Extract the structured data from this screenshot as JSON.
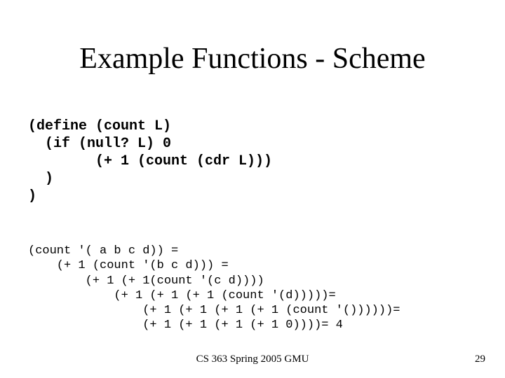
{
  "title": "Example Functions - Scheme",
  "code": "(define (count L)\n  (if (null? L) 0\n        (+ 1 (count (cdr L)))\n  )\n)",
  "trace": "(count '( a b c d)) =\n    (+ 1 (count '(b c d))) =\n        (+ 1 (+ 1(count '(c d))))\n            (+ 1 (+ 1 (+ 1 (count '(d)))))=\n                (+ 1 (+ 1 (+ 1 (+ 1 (count '())))))=\n                (+ 1 (+ 1 (+ 1 (+ 1 0))))= 4",
  "footer": {
    "center": "CS 363 Spring 2005 GMU",
    "page": "29"
  }
}
